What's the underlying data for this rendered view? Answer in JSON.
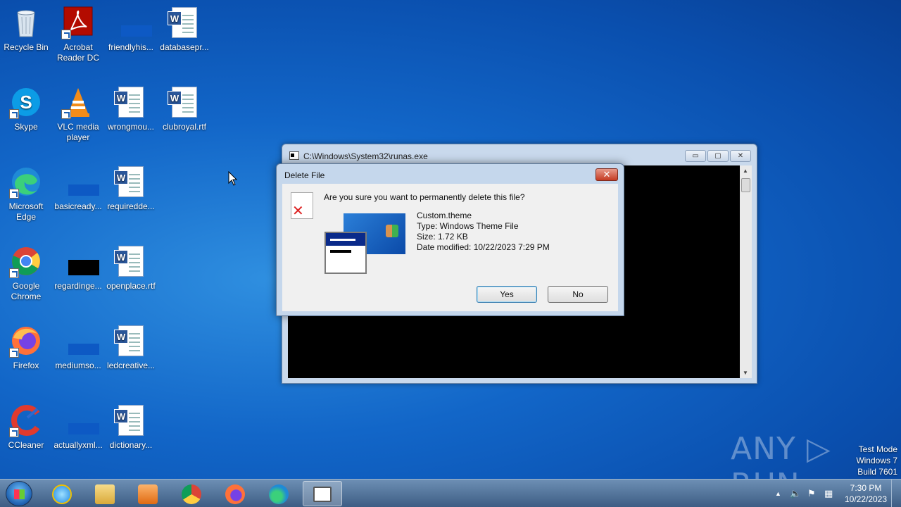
{
  "desktop": {
    "icons": [
      {
        "label": "Recycle Bin"
      },
      {
        "label": "Acrobat Reader DC"
      },
      {
        "label": "friendlyhis..."
      },
      {
        "label": "databasepr..."
      },
      {
        "label": "Skype"
      },
      {
        "label": "VLC media player"
      },
      {
        "label": "wrongmou..."
      },
      {
        "label": "clubroyal.rtf"
      },
      {
        "label": "Microsoft Edge"
      },
      {
        "label": "basicready..."
      },
      {
        "label": "requiredde..."
      },
      {
        "label": "Google Chrome"
      },
      {
        "label": "regardinge..."
      },
      {
        "label": "openplace.rtf"
      },
      {
        "label": "Firefox"
      },
      {
        "label": "mediumso..."
      },
      {
        "label": "ledcreative..."
      },
      {
        "label": "CCleaner"
      },
      {
        "label": "actuallyxml..."
      },
      {
        "label": "dictionary..."
      }
    ]
  },
  "runas_window": {
    "title": "C:\\Windows\\System32\\runas.exe",
    "minimize": "▭",
    "maximize": "▢",
    "close": "✕"
  },
  "delete_dialog": {
    "title": "Delete File",
    "question": "Are you sure you want to permanently delete this file?",
    "file_name": "Custom.theme",
    "file_type": "Type: Windows Theme File",
    "file_size": "Size: 1.72 KB",
    "file_date": "Date modified: 10/22/2023 7:29 PM",
    "yes_label": "Yes",
    "no_label": "No",
    "close_glyph": "✕"
  },
  "watermark": {
    "text": "ANY ▷ RUN"
  },
  "test_mode": {
    "line1": "Test Mode",
    "line2": "Windows 7",
    "line3": "Build 7601"
  },
  "taskbar": {
    "clock_time": "7:30 PM",
    "clock_date": "10/22/2023",
    "items": [
      "internet-explorer",
      "file-explorer",
      "media-player",
      "chrome",
      "firefox",
      "edge",
      "runas-console"
    ]
  },
  "colors": {
    "desktop_bg": "#1266c8",
    "taskbar_bg": "#4e6f96",
    "close_red": "#c43a22"
  }
}
